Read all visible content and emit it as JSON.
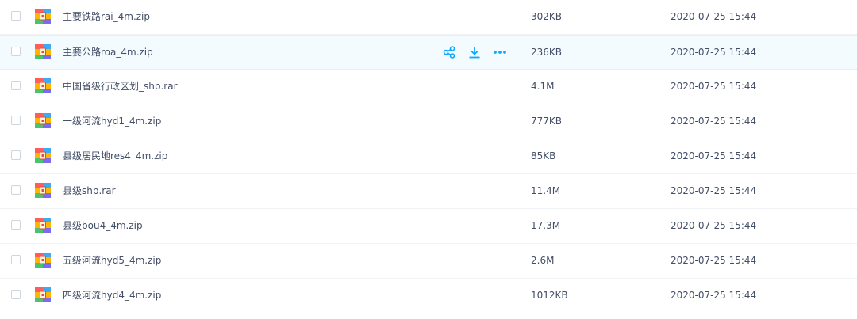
{
  "colors": {
    "accent": "#09aaff",
    "text": "#424e67",
    "row_hover": "#f4fbff",
    "divider": "#f1f2f4"
  },
  "hover_actions": [
    {
      "name": "share-icon"
    },
    {
      "name": "download-icon"
    },
    {
      "name": "more-icon"
    }
  ],
  "files": [
    {
      "name": "主要铁路rai_4m.zip",
      "size": "302KB",
      "time": "2020-07-25 15:44",
      "icon": "zip-archive-icon"
    },
    {
      "name": "主要公路roa_4m.zip",
      "size": "236KB",
      "time": "2020-07-25 15:44",
      "icon": "zip-archive-icon"
    },
    {
      "name": "中国省级行政区划_shp.rar",
      "size": "4.1M",
      "time": "2020-07-25 15:44",
      "icon": "zip-archive-icon"
    },
    {
      "name": "一级河流hyd1_4m.zip",
      "size": "777KB",
      "time": "2020-07-25 15:44",
      "icon": "zip-archive-icon"
    },
    {
      "name": "县级居民地res4_4m.zip",
      "size": "85KB",
      "time": "2020-07-25 15:44",
      "icon": "zip-archive-icon"
    },
    {
      "name": "县级shp.rar",
      "size": "11.4M",
      "time": "2020-07-25 15:44",
      "icon": "zip-archive-icon"
    },
    {
      "name": "县级bou4_4m.zip",
      "size": "17.3M",
      "time": "2020-07-25 15:44",
      "icon": "zip-archive-icon"
    },
    {
      "name": "五级河流hyd5_4m.zip",
      "size": "2.6M",
      "time": "2020-07-25 15:44",
      "icon": "zip-archive-icon"
    },
    {
      "name": "四级河流hyd4_4m.zip",
      "size": "1012KB",
      "time": "2020-07-25 15:44",
      "icon": "zip-archive-icon"
    }
  ]
}
